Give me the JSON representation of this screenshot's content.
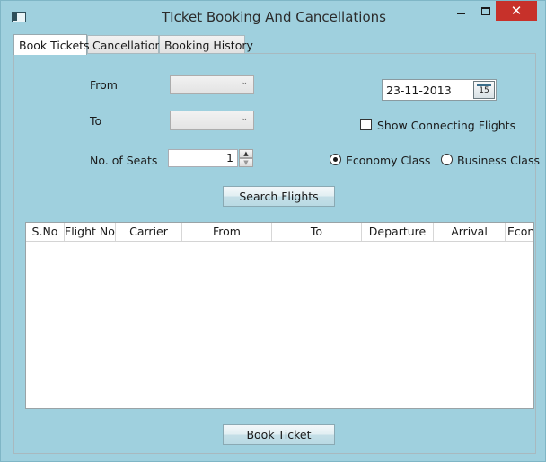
{
  "window": {
    "title": "TIcket Booking And Cancellations",
    "close_glyph": "✕"
  },
  "tabs": [
    {
      "label": "Book Tickets",
      "active": true
    },
    {
      "label": "Cancellations",
      "active": false
    },
    {
      "label": "Booking History",
      "active": false
    }
  ],
  "form": {
    "from_label": "From",
    "from_value": "",
    "to_label": "To",
    "to_value": "",
    "seats_label": "No. of Seats",
    "seats_value": "1",
    "date_value": "23-11-2013",
    "calendar_day": "15",
    "connecting_label": "Show Connecting Flights",
    "connecting_checked": false,
    "class_options": [
      {
        "label": "Economy Class",
        "checked": true
      },
      {
        "label": "Business Class",
        "checked": false
      }
    ]
  },
  "buttons": {
    "search": "Search Flights",
    "book": "Book Ticket"
  },
  "grid": {
    "columns": [
      "S.No",
      "Flight No.",
      "Carrier",
      "From",
      "To",
      "Departure",
      "Arrival",
      "Econo"
    ],
    "rows": []
  },
  "icons": {
    "app": "window-app-icon",
    "combo": "chevron-down-icon",
    "calendar": "calendar-icon"
  }
}
